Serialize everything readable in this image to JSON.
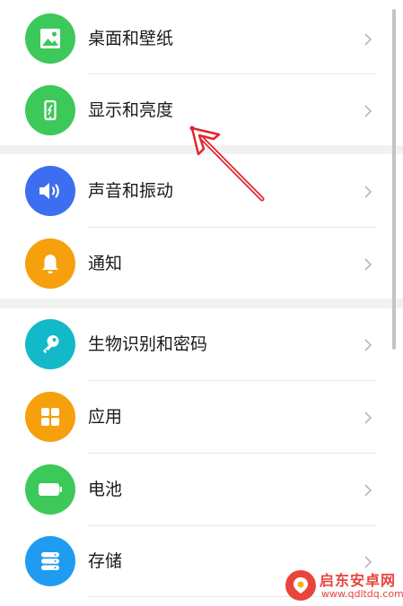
{
  "settings": {
    "items": [
      {
        "label": "桌面和壁纸",
        "icon": "image-icon",
        "color": "#3dc85a"
      },
      {
        "label": "显示和亮度",
        "icon": "phone-brightness-icon",
        "color": "#3dc85a"
      },
      {
        "label": "声音和振动",
        "icon": "speaker-icon",
        "color": "#3d6ef0"
      },
      {
        "label": "通知",
        "icon": "bell-icon",
        "color": "#f6a00d"
      },
      {
        "label": "生物识别和密码",
        "icon": "key-icon",
        "color": "#13b9c8"
      },
      {
        "label": "应用",
        "icon": "apps-grid-icon",
        "color": "#f6a00d"
      },
      {
        "label": "电池",
        "icon": "battery-icon",
        "color": "#3dc85a"
      },
      {
        "label": "存储",
        "icon": "storage-icon",
        "color": "#1f9cf0"
      }
    ]
  },
  "annotation": {
    "color": "#e0272d",
    "icon": "red-arrow-annotation"
  },
  "watermark": {
    "title": "启东安卓网",
    "url": "www.qdltdq.com"
  }
}
